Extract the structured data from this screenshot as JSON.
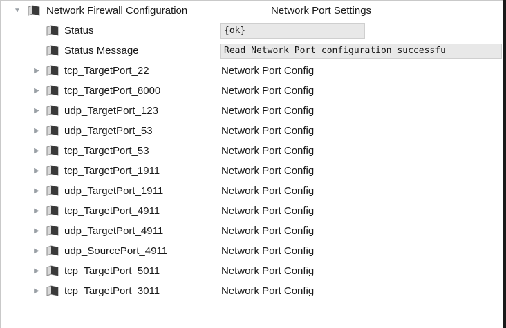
{
  "root": {
    "label": "Network Firewall Configuration",
    "value": "Network Port Settings",
    "icon": "folder-icon"
  },
  "properties": [
    {
      "label": "Status",
      "value": "{ok}"
    },
    {
      "label": "Status Message",
      "value": "Read Network Port configuration successfu"
    }
  ],
  "ports": [
    {
      "label": "tcp_TargetPort_22",
      "value": "Network Port Config"
    },
    {
      "label": "tcp_TargetPort_8000",
      "value": "Network Port Config"
    },
    {
      "label": "udp_TargetPort_123",
      "value": "Network Port Config"
    },
    {
      "label": "udp_TargetPort_53",
      "value": "Network Port Config"
    },
    {
      "label": "tcp_TargetPort_53",
      "value": "Network Port Config"
    },
    {
      "label": "tcp_TargetPort_1911",
      "value": "Network Port Config"
    },
    {
      "label": "udp_TargetPort_1911",
      "value": "Network Port Config"
    },
    {
      "label": "tcp_TargetPort_4911",
      "value": "Network Port Config"
    },
    {
      "label": "udp_TargetPort_4911",
      "value": "Network Port Config"
    },
    {
      "label": "udp_SourcePort_4911",
      "value": "Network Port Config"
    },
    {
      "label": "tcp_TargetPort_5011",
      "value": "Network Port Config"
    },
    {
      "label": "tcp_TargetPort_3011",
      "value": "Network Port Config"
    }
  ],
  "colors": {
    "field_bg": "#e8e8e8",
    "toggle": "#9aa0a6",
    "icon_dark": "#3a3a3a",
    "icon_light": "#d9d9d9"
  }
}
